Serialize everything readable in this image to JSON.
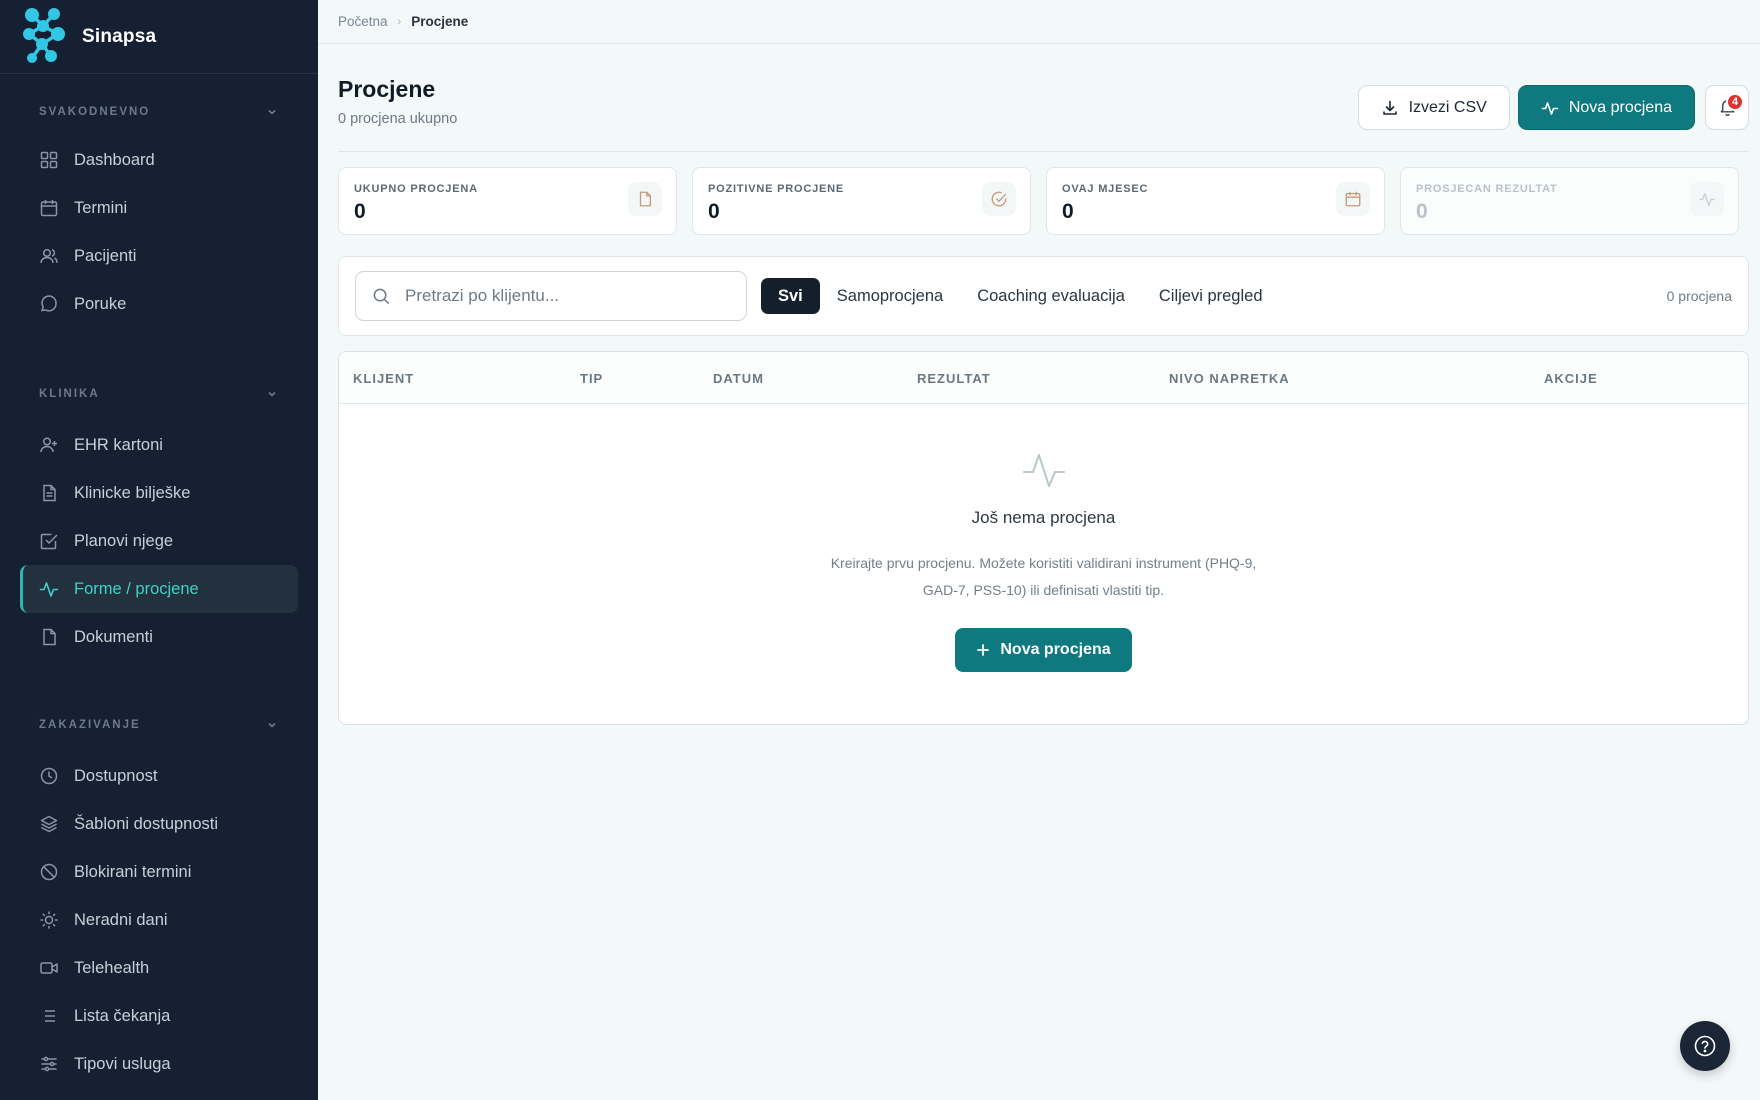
{
  "brand": {
    "name": "Sinapsa"
  },
  "sidebar": {
    "sections": [
      {
        "title": "SVAKODNEVNO",
        "items": [
          {
            "label": "Dashboard",
            "icon": "grid-icon"
          },
          {
            "label": "Termini",
            "icon": "calendar-icon"
          },
          {
            "label": "Pacijenti",
            "icon": "users-icon"
          },
          {
            "label": "Poruke",
            "icon": "message-icon"
          }
        ]
      },
      {
        "title": "KLINIKA",
        "items": [
          {
            "label": "EHR kartoni",
            "icon": "user-plus-icon"
          },
          {
            "label": "Klinicke bilješke",
            "icon": "file-text-icon"
          },
          {
            "label": "Planovi njege",
            "icon": "check-square-icon"
          },
          {
            "label": "Forme / procjene",
            "icon": "activity-icon",
            "active": true
          },
          {
            "label": "Dokumenti",
            "icon": "file-icon"
          }
        ]
      },
      {
        "title": "ZAKAZIVANJE",
        "items": [
          {
            "label": "Dostupnost",
            "icon": "clock-icon"
          },
          {
            "label": "Šabloni dostupnosti",
            "icon": "layers-icon"
          },
          {
            "label": "Blokirani termini",
            "icon": "ban-icon"
          },
          {
            "label": "Neradni dani",
            "icon": "sun-icon"
          },
          {
            "label": "Telehealth",
            "icon": "video-icon"
          },
          {
            "label": "Lista čekanja",
            "icon": "list-icon"
          },
          {
            "label": "Tipovi usluga",
            "icon": "sliders-icon"
          }
        ]
      }
    ]
  },
  "breadcrumb": {
    "home": "Početna",
    "current": "Procjene"
  },
  "header": {
    "title": "Procjene",
    "subtitle": "0 procjena ukupno",
    "export_label": "Izvezi CSV",
    "new_label": "Nova procjena",
    "notifications": "4"
  },
  "stats": [
    {
      "label": "UKUPNO PROCJENA",
      "value": "0",
      "icon": "file-icon"
    },
    {
      "label": "POZITIVNE PROCJENE",
      "value": "0",
      "icon": "check-circle-icon"
    },
    {
      "label": "OVAJ MJESEC",
      "value": "0",
      "icon": "calendar-icon"
    },
    {
      "label": "PROSJECAN REZULTAT",
      "value": "0",
      "icon": "activity-icon"
    }
  ],
  "filters": {
    "search_placeholder": "Pretrazi po klijentu...",
    "tabs": [
      "Svi",
      "Samoprocjena",
      "Coaching evaluacija",
      "Ciljevi pregled"
    ],
    "active_tab": "Svi",
    "count": "0 procjena"
  },
  "table": {
    "columns": [
      "KLIJENT",
      "TIP",
      "DATUM",
      "REZULTAT",
      "NIVO NAPRETKA",
      "AKCIJE"
    ],
    "rows": []
  },
  "empty_state": {
    "title": "Još nema procjena",
    "description": "Kreirajte prvu procjenu. Možete koristiti validirani instrument (PHQ-9, GAD-7, PSS-10) ili definisati vlastiti tip.",
    "button_label": "Nova procjena"
  },
  "colors": {
    "accent": "#0f7980",
    "sidebar_bg": "#152132",
    "active_text": "#3dd2c8",
    "badge": "#e0302f"
  }
}
